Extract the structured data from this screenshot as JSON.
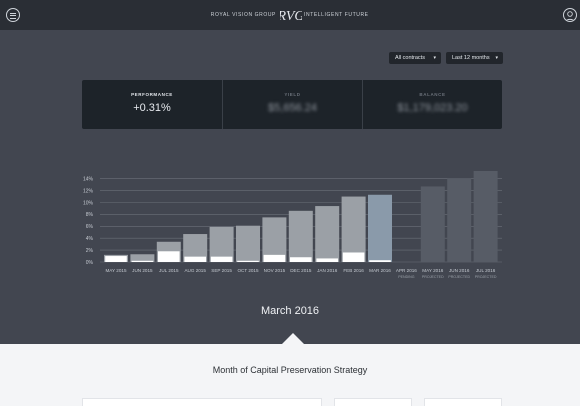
{
  "header": {
    "brand_left": "ROYAL VISION GROUP",
    "logo_text": "RVG",
    "brand_right": "INTELLIGENT FUTURE"
  },
  "filters": {
    "contracts": "All contracts",
    "period": "Last 12 months"
  },
  "stats": [
    {
      "label": "PERFORMANCE",
      "value": "+0.31%"
    },
    {
      "label": "YIELD",
      "value": "$5,656.24"
    },
    {
      "label": "BALANCE",
      "value": "$1,179,023.20"
    }
  ],
  "chart_data": {
    "type": "bar",
    "ylim": [
      0,
      15
    ],
    "y_ticks": [
      "0%",
      "2%",
      "4%",
      "6%",
      "8%",
      "10%",
      "12%",
      "14%"
    ],
    "y_tick_values": [
      0,
      2,
      4,
      6,
      8,
      10,
      12,
      14
    ],
    "categories": [
      "MAY 2015",
      "JUN 2015",
      "JUL 2015",
      "AUG 2015",
      "SEP 2015",
      "OCT 2015",
      "NOV 2015",
      "DEC 2015",
      "JAN 2016",
      "FEB 2016",
      "MAR 2016",
      "APR 2016",
      "MAY 2016",
      "JUN 2016",
      "JUL 2016"
    ],
    "sublabels": [
      "",
      "",
      "",
      "",
      "",
      "",
      "",
      "",
      "",
      "",
      "",
      "PENDING",
      "PROJECTED",
      "PROJECTED",
      "PROJECTED"
    ],
    "series": [
      {
        "values": [
          1.2,
          1.3,
          3.4,
          4.7,
          5.9,
          6.1,
          7.5,
          8.6,
          9.4,
          11.0,
          11.3,
          null,
          12.7,
          14.0,
          15.3
        ]
      },
      {
        "values": [
          1.0,
          0.2,
          1.8,
          0.9,
          0.9,
          0.2,
          1.2,
          0.8,
          0.6,
          1.6,
          0.3,
          null,
          0,
          0,
          0
        ]
      }
    ],
    "colors": {
      "actual": "#9ba0a6",
      "current": "#8a9aaa",
      "projected": "#575c66",
      "monthly": "#ffffff",
      "grid": "#6b7079"
    }
  },
  "selected_month": "March 2016",
  "section_title": "Month of Capital Preservation Strategy"
}
